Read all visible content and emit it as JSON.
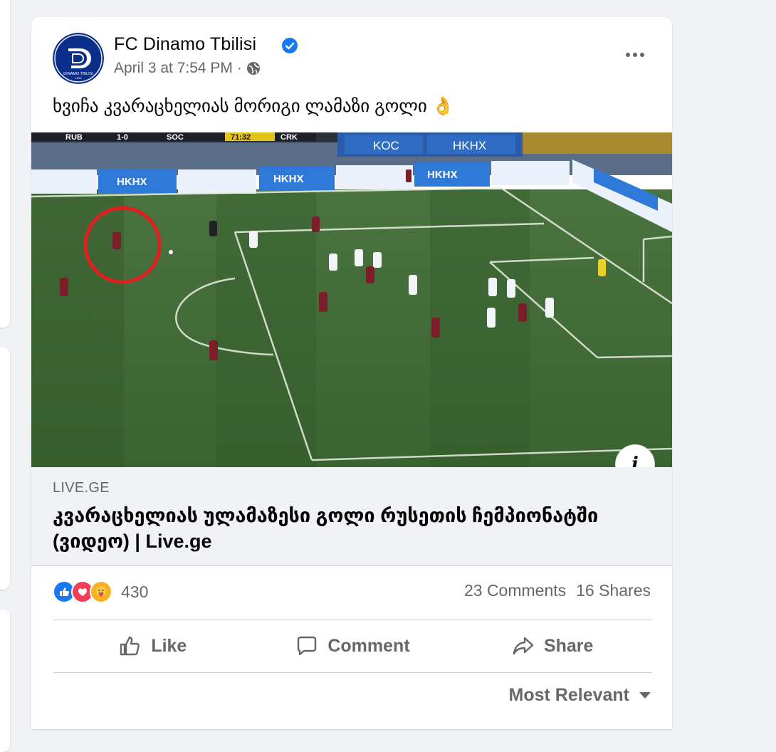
{
  "page": {
    "name": "FC Dinamo Tbilisi",
    "timestamp": "April 3 at 7:54 PM",
    "separator": "·",
    "avatar_label": "DINAMO TBILISI",
    "avatar_year": "1925"
  },
  "post": {
    "text": "ხვიჩა კვარაცხელიას მორიგი ლამაზი გოლი 👌"
  },
  "video": {
    "scoreboard": {
      "team1": "RUB",
      "score": "1-0",
      "team2": "SOC",
      "clock": "71:32",
      "extra": "CRK"
    },
    "ad_boards": [
      "KOC",
      "HKHX",
      "HKHX",
      "HKHX",
      "HKHX"
    ]
  },
  "link": {
    "domain": "LIVE.GE",
    "title": "კვარაცხელიას ულამაზესი გოლი რუსეთის ჩემპიონატში (ვიდეო) | Live.ge"
  },
  "stats": {
    "reaction_count": "430",
    "comments": "23 Comments",
    "shares": "16 Shares"
  },
  "actions": {
    "like": "Like",
    "comment": "Comment",
    "share": "Share"
  },
  "sort": {
    "label": "Most Relevant"
  },
  "colors": {
    "brand_blue": "#1877f2",
    "love_red": "#f33e58",
    "care_yellow": "#f7b125",
    "pitch_green": "#3f6a36"
  },
  "icons": [
    "verified-icon",
    "globe-icon",
    "more-icon",
    "info-icon",
    "like-reaction-icon",
    "love-reaction-icon",
    "care-reaction-icon",
    "thumbs-up-icon",
    "comment-icon",
    "share-icon",
    "caret-down-icon"
  ]
}
